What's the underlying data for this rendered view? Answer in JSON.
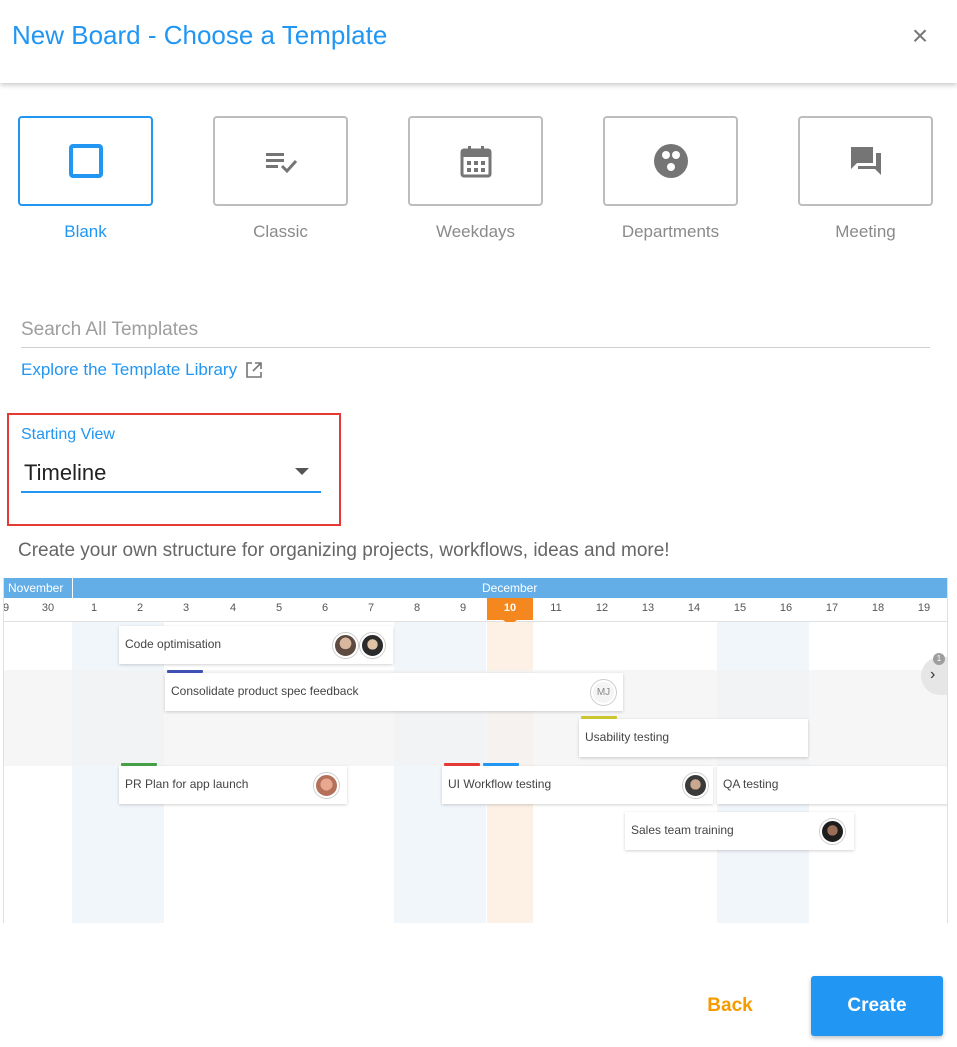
{
  "dialog": {
    "title": "New Board - Choose a Template",
    "close_icon": "close-icon"
  },
  "templates": [
    {
      "label": "Blank",
      "icon": "blank-square-icon",
      "selected": true
    },
    {
      "label": "Classic",
      "icon": "list-check-icon",
      "selected": false
    },
    {
      "label": "Weekdays",
      "icon": "calendar-icon",
      "selected": false
    },
    {
      "label": "Departments",
      "icon": "departments-icon",
      "selected": false
    },
    {
      "label": "Meeting",
      "icon": "chat-bubbles-icon",
      "selected": false
    }
  ],
  "search": {
    "placeholder": "Search All Templates",
    "value": ""
  },
  "explore_link": {
    "label": "Explore the Template Library",
    "icon": "external-link-icon"
  },
  "starting_view": {
    "label": "Starting View",
    "value": "Timeline"
  },
  "description": "Create your own structure for organizing projects, workflows, ideas and more!",
  "timeline": {
    "months": [
      "November",
      "December"
    ],
    "days": [
      "9",
      "30",
      "1",
      "2",
      "3",
      "4",
      "5",
      "6",
      "7",
      "8",
      "9",
      "10",
      "11",
      "12",
      "13",
      "14",
      "15",
      "16",
      "17",
      "18",
      "19"
    ],
    "today": "10",
    "scroll_badge": "1",
    "items": [
      {
        "label": "Code optimisation"
      },
      {
        "label": "Consolidate product spec feedback",
        "avatar_initials": "MJ"
      },
      {
        "label": "Usability testing"
      },
      {
        "label": "PR Plan for app launch"
      },
      {
        "label": "UI Workflow testing"
      },
      {
        "label": "QA testing"
      },
      {
        "label": "Sales team training"
      }
    ]
  },
  "footer": {
    "back_label": "Back",
    "create_label": "Create"
  },
  "colors": {
    "accent": "#2196f3",
    "back": "#f59b00",
    "highlight_box": "#e53935",
    "today": "#f5871f"
  }
}
